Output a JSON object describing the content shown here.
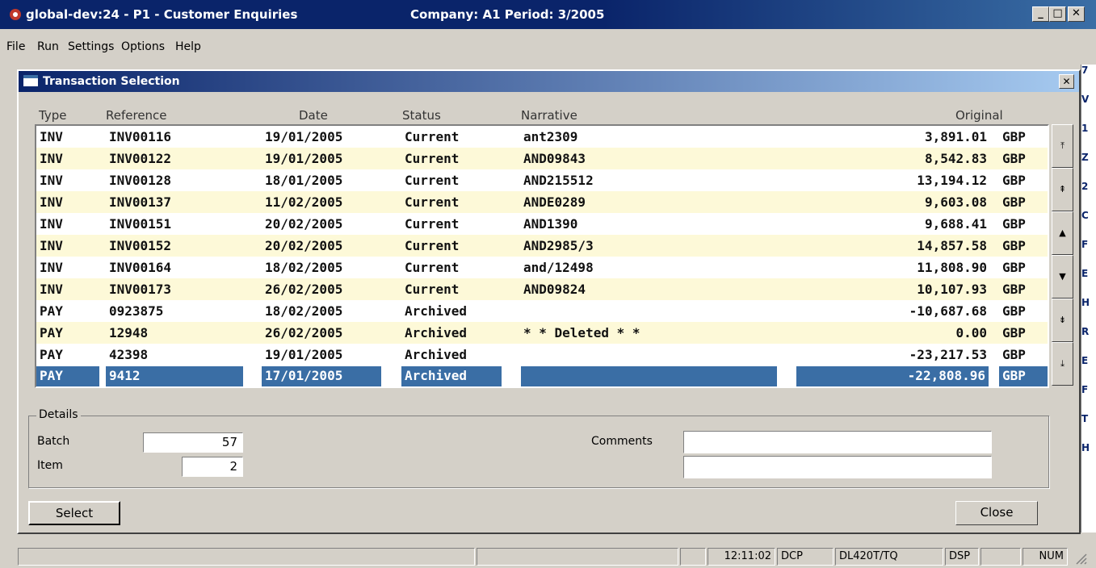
{
  "window": {
    "title": "global-dev:24 - P1 - Customer Enquiries",
    "company_period": "Company: A1  Period: 3/2005",
    "min": "_",
    "max": "□",
    "close": "✕"
  },
  "menu": [
    "File",
    "Run",
    "Settings",
    "Options",
    "Help"
  ],
  "dialog": {
    "title": "Transaction Selection",
    "close": "✕",
    "columns": [
      "Type",
      "Reference",
      "Date",
      "Status",
      "Narrative",
      "Original"
    ],
    "rows": [
      {
        "type": "INV",
        "ref": "INV00116",
        "date": "19/01/2005",
        "status": "Current",
        "narrative": "ant2309",
        "amount": "3,891.01",
        "cur": "GBP"
      },
      {
        "type": "INV",
        "ref": "INV00122",
        "date": "19/01/2005",
        "status": "Current",
        "narrative": "AND09843",
        "amount": "8,542.83",
        "cur": "GBP"
      },
      {
        "type": "INV",
        "ref": "INV00128",
        "date": "18/01/2005",
        "status": "Current",
        "narrative": "AND215512",
        "amount": "13,194.12",
        "cur": "GBP"
      },
      {
        "type": "INV",
        "ref": "INV00137",
        "date": "11/02/2005",
        "status": "Current",
        "narrative": "ANDE0289",
        "amount": "9,603.08",
        "cur": "GBP"
      },
      {
        "type": "INV",
        "ref": "INV00151",
        "date": "20/02/2005",
        "status": "Current",
        "narrative": "AND1390",
        "amount": "9,688.41",
        "cur": "GBP"
      },
      {
        "type": "INV",
        "ref": "INV00152",
        "date": "20/02/2005",
        "status": "Current",
        "narrative": "AND2985/3",
        "amount": "14,857.58",
        "cur": "GBP"
      },
      {
        "type": "INV",
        "ref": "INV00164",
        "date": "18/02/2005",
        "status": "Current",
        "narrative": "and/12498",
        "amount": "11,808.90",
        "cur": "GBP"
      },
      {
        "type": "INV",
        "ref": "INV00173",
        "date": "26/02/2005",
        "status": "Current",
        "narrative": "AND09824",
        "amount": "10,107.93",
        "cur": "GBP"
      },
      {
        "type": "PAY",
        "ref": "0923875",
        "date": "18/02/2005",
        "status": "Archived",
        "narrative": "",
        "amount": "-10,687.68",
        "cur": "GBP"
      },
      {
        "type": "PAY",
        "ref": "12948",
        "date": "26/02/2005",
        "status": "Archived",
        "narrative": "* * Deleted * *",
        "amount": "0.00",
        "cur": "GBP"
      },
      {
        "type": "PAY",
        "ref": "42398",
        "date": "19/01/2005",
        "status": "Archived",
        "narrative": "",
        "amount": "-23,217.53",
        "cur": "GBP"
      },
      {
        "type": "PAY",
        "ref": "9412",
        "date": "17/01/2005",
        "status": "Archived",
        "narrative": "",
        "amount": "-22,808.96",
        "cur": "GBP"
      }
    ],
    "selected_row": 11,
    "scroll_buttons": [
      "⤒",
      "⇞",
      "▲",
      "▼",
      "⇟",
      "⤓"
    ],
    "details": {
      "legend": "Details",
      "batch_label": "Batch",
      "batch_value": "57",
      "item_label": "Item",
      "item_value": "2",
      "comments_label": "Comments",
      "comments_1": "",
      "comments_2": ""
    },
    "select_button": "Select",
    "close_button": "Close"
  },
  "behind_text": [
    "7",
    "V",
    "1",
    "Z",
    "2",
    "C",
    "F",
    "E",
    "H",
    "R",
    "E",
    "F",
    "T",
    "H"
  ],
  "statusbar": {
    "time": "12:11:02",
    "dcp": "DCP",
    "printer": "DL420T/TQ",
    "dsp": "DSP",
    "num": "NUM"
  },
  "colors": {
    "title_bg": "#0a246a",
    "row_alt": "#fdf9d8",
    "selection": "#3a6ea5",
    "chrome": "#d4d0c8"
  }
}
